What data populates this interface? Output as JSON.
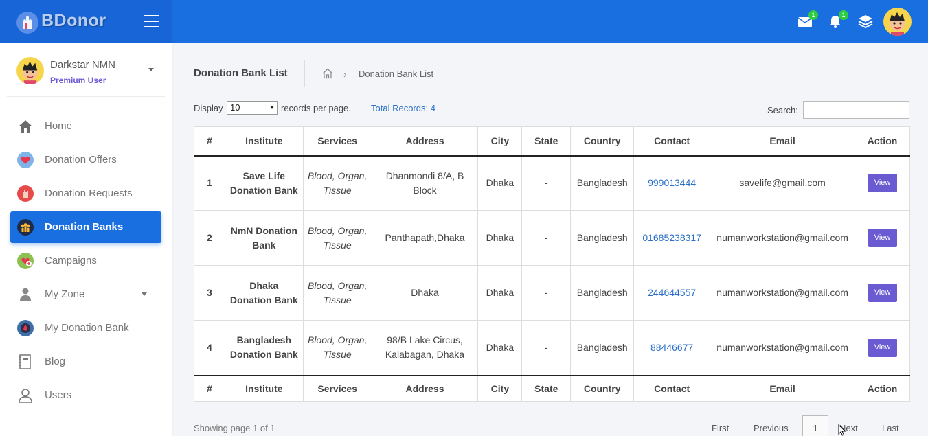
{
  "app": {
    "name": "BDonor"
  },
  "topbar": {
    "mail_badge": "1",
    "bell_badge": "1"
  },
  "user": {
    "name": "Darkstar NMN",
    "role": "Premium User"
  },
  "sidebar": {
    "items": [
      {
        "label": "Home",
        "icon": "home-icon"
      },
      {
        "label": "Donation Offers",
        "icon": "heart-icon"
      },
      {
        "label": "Donation Requests",
        "icon": "hand-icon"
      },
      {
        "label": "Donation Banks",
        "icon": "bank-icon",
        "active": true
      },
      {
        "label": "Campaigns",
        "icon": "campaign-icon"
      },
      {
        "label": "My Zone",
        "icon": "user-icon",
        "has_dropdown": true
      },
      {
        "label": "My Donation Bank",
        "icon": "drop-icon"
      },
      {
        "label": "Blog",
        "icon": "notebook-icon"
      },
      {
        "label": "Users",
        "icon": "users-icon"
      }
    ]
  },
  "page": {
    "title": "Donation Bank List",
    "breadcrumb_current": "Donation Bank List"
  },
  "controls": {
    "display_label": "Display",
    "display_value": "10",
    "records_label": "records per page.",
    "total_records": "Total Records: 4",
    "search_label": "Search:",
    "search_value": ""
  },
  "table": {
    "columns": [
      "#",
      "Institute",
      "Services",
      "Address",
      "City",
      "State",
      "Country",
      "Contact",
      "Email",
      "Action"
    ],
    "rows": [
      {
        "num": "1",
        "institute": "Save Life Donation Bank",
        "services": "Blood, Organ, Tissue",
        "address": "Dhanmondi 8/A, B Block",
        "city": "Dhaka",
        "state": "-",
        "country": "Bangladesh",
        "contact": "999013444",
        "email": "savelife@gmail.com",
        "action": "View"
      },
      {
        "num": "2",
        "institute": "NmN Donation Bank",
        "services": "Blood, Organ, Tissue",
        "address": "Panthapath,Dhaka",
        "city": "Dhaka",
        "state": "-",
        "country": "Bangladesh",
        "contact": "01685238317",
        "email": "numanworkstation@gmail.com",
        "action": "View"
      },
      {
        "num": "3",
        "institute": "Dhaka Donation Bank",
        "services": "Blood, Organ, Tissue",
        "address": "Dhaka",
        "city": "Dhaka",
        "state": "-",
        "country": "Bangladesh",
        "contact": "244644557",
        "email": "numanworkstation@gmail.com",
        "action": "View"
      },
      {
        "num": "4",
        "institute": "Bangladesh Donation Bank",
        "services": "Blood, Organ, Tissue",
        "address": "98/B Lake Circus, Kalabagan, Dhaka",
        "city": "Dhaka",
        "state": "-",
        "country": "Bangladesh",
        "contact": "88446677",
        "email": "numanworkstation@gmail.com",
        "action": "View"
      }
    ]
  },
  "pagination": {
    "showing": "Showing page 1 of 1",
    "first": "First",
    "previous": "Previous",
    "current": "1",
    "next": "Next",
    "last": "Last"
  },
  "colors": {
    "primary": "#1a6fe0",
    "accent": "#6b5bd2",
    "badge": "#2ecc40",
    "link": "#2a6fc9"
  }
}
